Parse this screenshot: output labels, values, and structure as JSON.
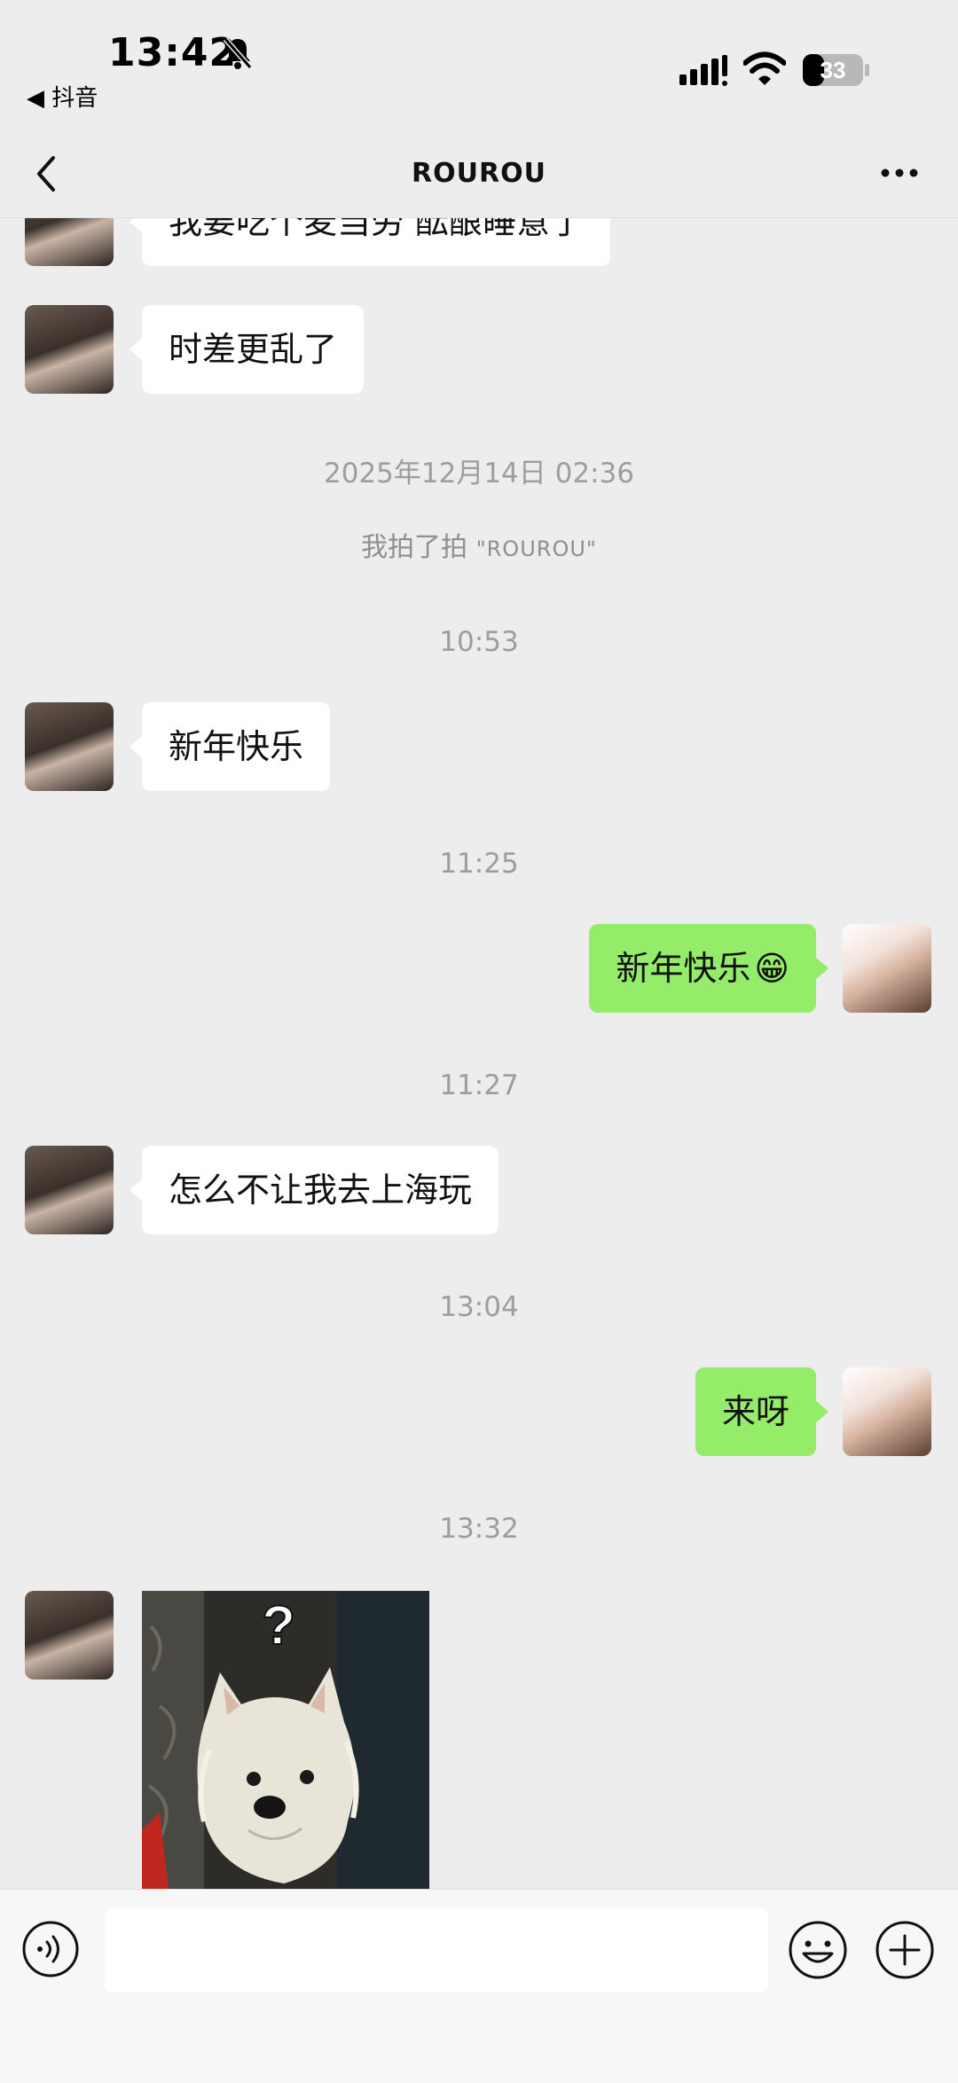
{
  "status_bar": {
    "time": "13:42",
    "back_app": "◀ 抖音",
    "battery": "33"
  },
  "nav": {
    "title": "ROUROU"
  },
  "messages": {
    "partial_top": "我要吃个麦当劳 酝酿睡意了",
    "m1": "时差更乱了",
    "ts1": "2025年12月14日 02:36",
    "pat_prefix": "我拍了拍 ",
    "pat_name": "\"ROUROU\"",
    "ts2": "10:53",
    "m2": "新年快乐",
    "ts3": "11:25",
    "m3": "新年快乐",
    "m3_emoji": "😁",
    "ts4": "11:27",
    "m4": "怎么不让我去上海玩",
    "ts5": "13:04",
    "m5": "来呀",
    "ts6": "13:32",
    "sticker_mark": "?"
  },
  "colors": {
    "background": "#ededed",
    "bubble_out": "#95ec69",
    "bubble_in": "#ffffff",
    "timestamp": "#9d9d9d"
  },
  "input": {
    "value": "",
    "placeholder": ""
  }
}
